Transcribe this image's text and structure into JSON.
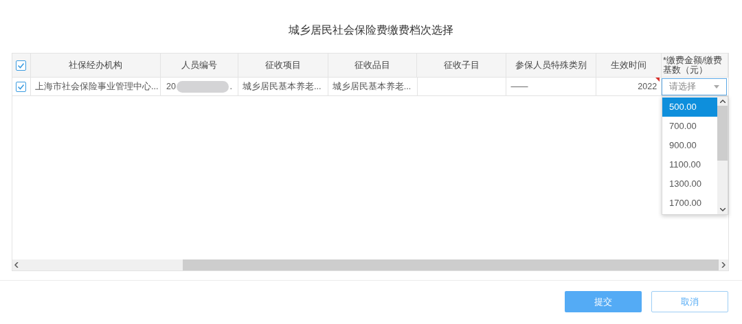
{
  "dialog": {
    "title": "城乡居民社会保险费缴费档次选择"
  },
  "table": {
    "header_checkbox": {
      "checked": true
    },
    "columns": [
      "社保经办机构",
      "人员编号",
      "征收项目",
      "征收品目",
      "征收子目",
      "参保人员特殊类别",
      "生效时间",
      "*缴费金额/缴费基数（元）"
    ],
    "rows": [
      {
        "checked": true,
        "agency": "上海市社会保险事业管理中心...",
        "person_id_start": "20",
        "person_id_end": ".",
        "item": "城乡居民基本养老...",
        "category": "城乡居民基本养老...",
        "subitem": "",
        "special_type": "——",
        "effective": "2022",
        "amount_placeholder": "请选择"
      }
    ]
  },
  "dropdown": {
    "options": [
      {
        "label": "500.00",
        "selected": true
      },
      {
        "label": "700.00",
        "selected": false
      },
      {
        "label": "900.00",
        "selected": false
      },
      {
        "label": "1100.00",
        "selected": false
      },
      {
        "label": "1300.00",
        "selected": false
      },
      {
        "label": "1700.00",
        "selected": false
      }
    ]
  },
  "buttons": [
    {
      "label": "提交",
      "kind": "primary"
    },
    {
      "label": "取消",
      "kind": "secondary"
    }
  ]
}
